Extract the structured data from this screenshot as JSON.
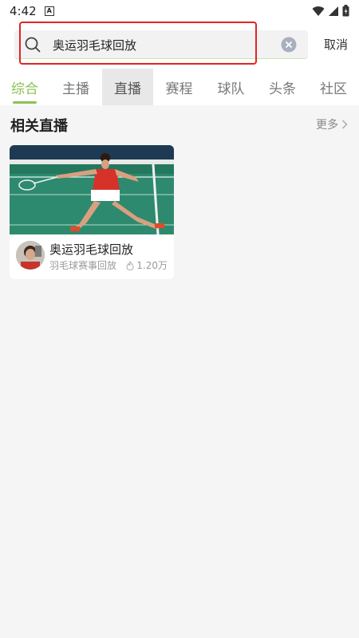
{
  "status_bar": {
    "time": "4:42",
    "notification_icon": "A"
  },
  "search": {
    "query": "奥运羽毛球回放",
    "cancel_label": "取消"
  },
  "tabs": [
    {
      "label": "综合",
      "state": "active"
    },
    {
      "label": "主播",
      "state": "normal"
    },
    {
      "label": "直播",
      "state": "pressed"
    },
    {
      "label": "赛程",
      "state": "normal"
    },
    {
      "label": "球队",
      "state": "normal"
    },
    {
      "label": "头条",
      "state": "normal"
    },
    {
      "label": "社区",
      "state": "normal"
    }
  ],
  "section": {
    "title": "相关直播",
    "more_label": "更多"
  },
  "live_card": {
    "title": "奥运羽毛球回放",
    "subtitle": "羽毛球赛事回放",
    "views": "1.20万"
  },
  "colors": {
    "accent": "#8cc152",
    "highlight_border": "#e02424",
    "court_green": "#2e8a6e"
  }
}
